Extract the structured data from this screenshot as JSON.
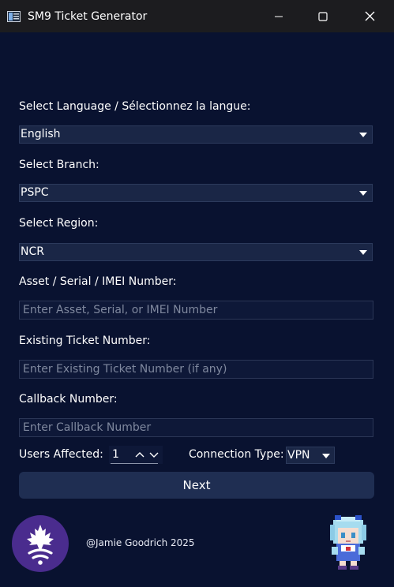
{
  "window": {
    "title": "SM9 Ticket Generator",
    "icons": {
      "app": "app-window-icon",
      "minimize": "minimize-icon",
      "maximize": "maximize-icon",
      "close": "close-icon"
    }
  },
  "form": {
    "language_label": "Select Language / Sélectionnez la langue:",
    "language_value": "English",
    "branch_label": "Select Branch:",
    "branch_value": "PSPC",
    "region_label": "Select Region:",
    "region_value": "NCR",
    "asset_label": "Asset / Serial / IMEI Number:",
    "asset_placeholder": "Enter Asset, Serial, or IMEI Number",
    "ticket_label": "Existing Ticket Number:",
    "ticket_placeholder": "Enter Existing Ticket Number (if any)",
    "callback_label": "Callback Number:",
    "callback_placeholder": "Enter Callback Number",
    "users_label": "Users Affected:",
    "users_value": "1",
    "connection_label": "Connection Type:",
    "connection_value": "VPN",
    "next_label": "Next"
  },
  "footer": {
    "credit": "@Jamie Goodrich 2025",
    "logo_icon": "maple-leaf-wifi-logo-icon",
    "mascot_icon": "pixel-mascot-icon"
  },
  "colors": {
    "background": "#091230",
    "titlebar": "#1c1c1f",
    "button": "#1f2e52",
    "logo": "#4a2c8e"
  }
}
